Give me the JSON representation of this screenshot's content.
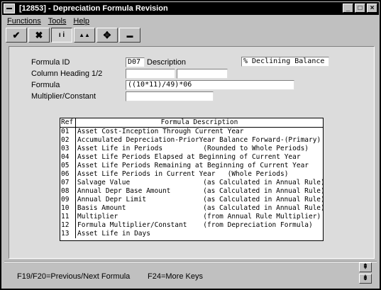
{
  "window": {
    "title": "[12853] - Depreciation Formula Revision",
    "buttons": {
      "minimize": "_",
      "maximize": "□",
      "close": "×"
    }
  },
  "menu": [
    "Functions",
    "Tools",
    "Help"
  ],
  "toolbar": [
    {
      "name": "check-icon",
      "glyph": "✔"
    },
    {
      "name": "x-icon",
      "glyph": "✖"
    },
    {
      "name": "inquire-icon",
      "glyph": "ı i"
    },
    {
      "name": "mountain-icon",
      "glyph": "▲▲"
    },
    {
      "name": "add-icon",
      "glyph": "✥"
    },
    {
      "name": "delete-icon",
      "glyph": "▬"
    }
  ],
  "form": {
    "formula_id_label": "Formula ID",
    "formula_id_value": "D07",
    "description_label": "Description",
    "description_value": "% Declining Balance",
    "column_heading_label": "Column Heading 1/2",
    "column_heading_1": "",
    "column_heading_2": "",
    "formula_label": "Formula",
    "formula_value": "((10*11)/49)*06",
    "multiplier_label": "Multiplier/Constant",
    "multiplier_value": ""
  },
  "list": {
    "headers": [
      "Ref",
      "Formula Description"
    ],
    "rows": [
      [
        "01",
        "Asset Cost-Inception Through Current Year"
      ],
      [
        "02",
        "Accumulated Depreciation-PriorYear Balance Forward-(Primary)"
      ],
      [
        "03",
        "Asset Life in Periods          (Rounded to Whole Periods)"
      ],
      [
        "04",
        "Asset Life Periods Elapsed at Beginning of Current Year"
      ],
      [
        "05",
        "Asset Life Periods Remaining at Beginning of Current Year"
      ],
      [
        "06",
        "Asset Life Periods in Current Year   (Whole Periods)"
      ],
      [
        "07",
        "Salvage Value                  (as Calculated in Annual Rule)"
      ],
      [
        "08",
        "Annual Depr Base Amount        (as Calculated in Annual Rule)"
      ],
      [
        "09",
        "Annual Depr Limit              (as Calculated in Annual Rule)"
      ],
      [
        "10",
        "Basis Amount                   (as Calculated in Annual Rule)"
      ],
      [
        "11",
        "Multiplier                     (from Annual Rule Multiplier)"
      ],
      [
        "12",
        "Formula Multiplier/Constant    (from Depreciation Formula)"
      ],
      [
        "13",
        "Asset Life in Days"
      ]
    ]
  },
  "status": {
    "left": "F19/F20=Previous/Next Formula",
    "right": "F24=More Keys"
  }
}
